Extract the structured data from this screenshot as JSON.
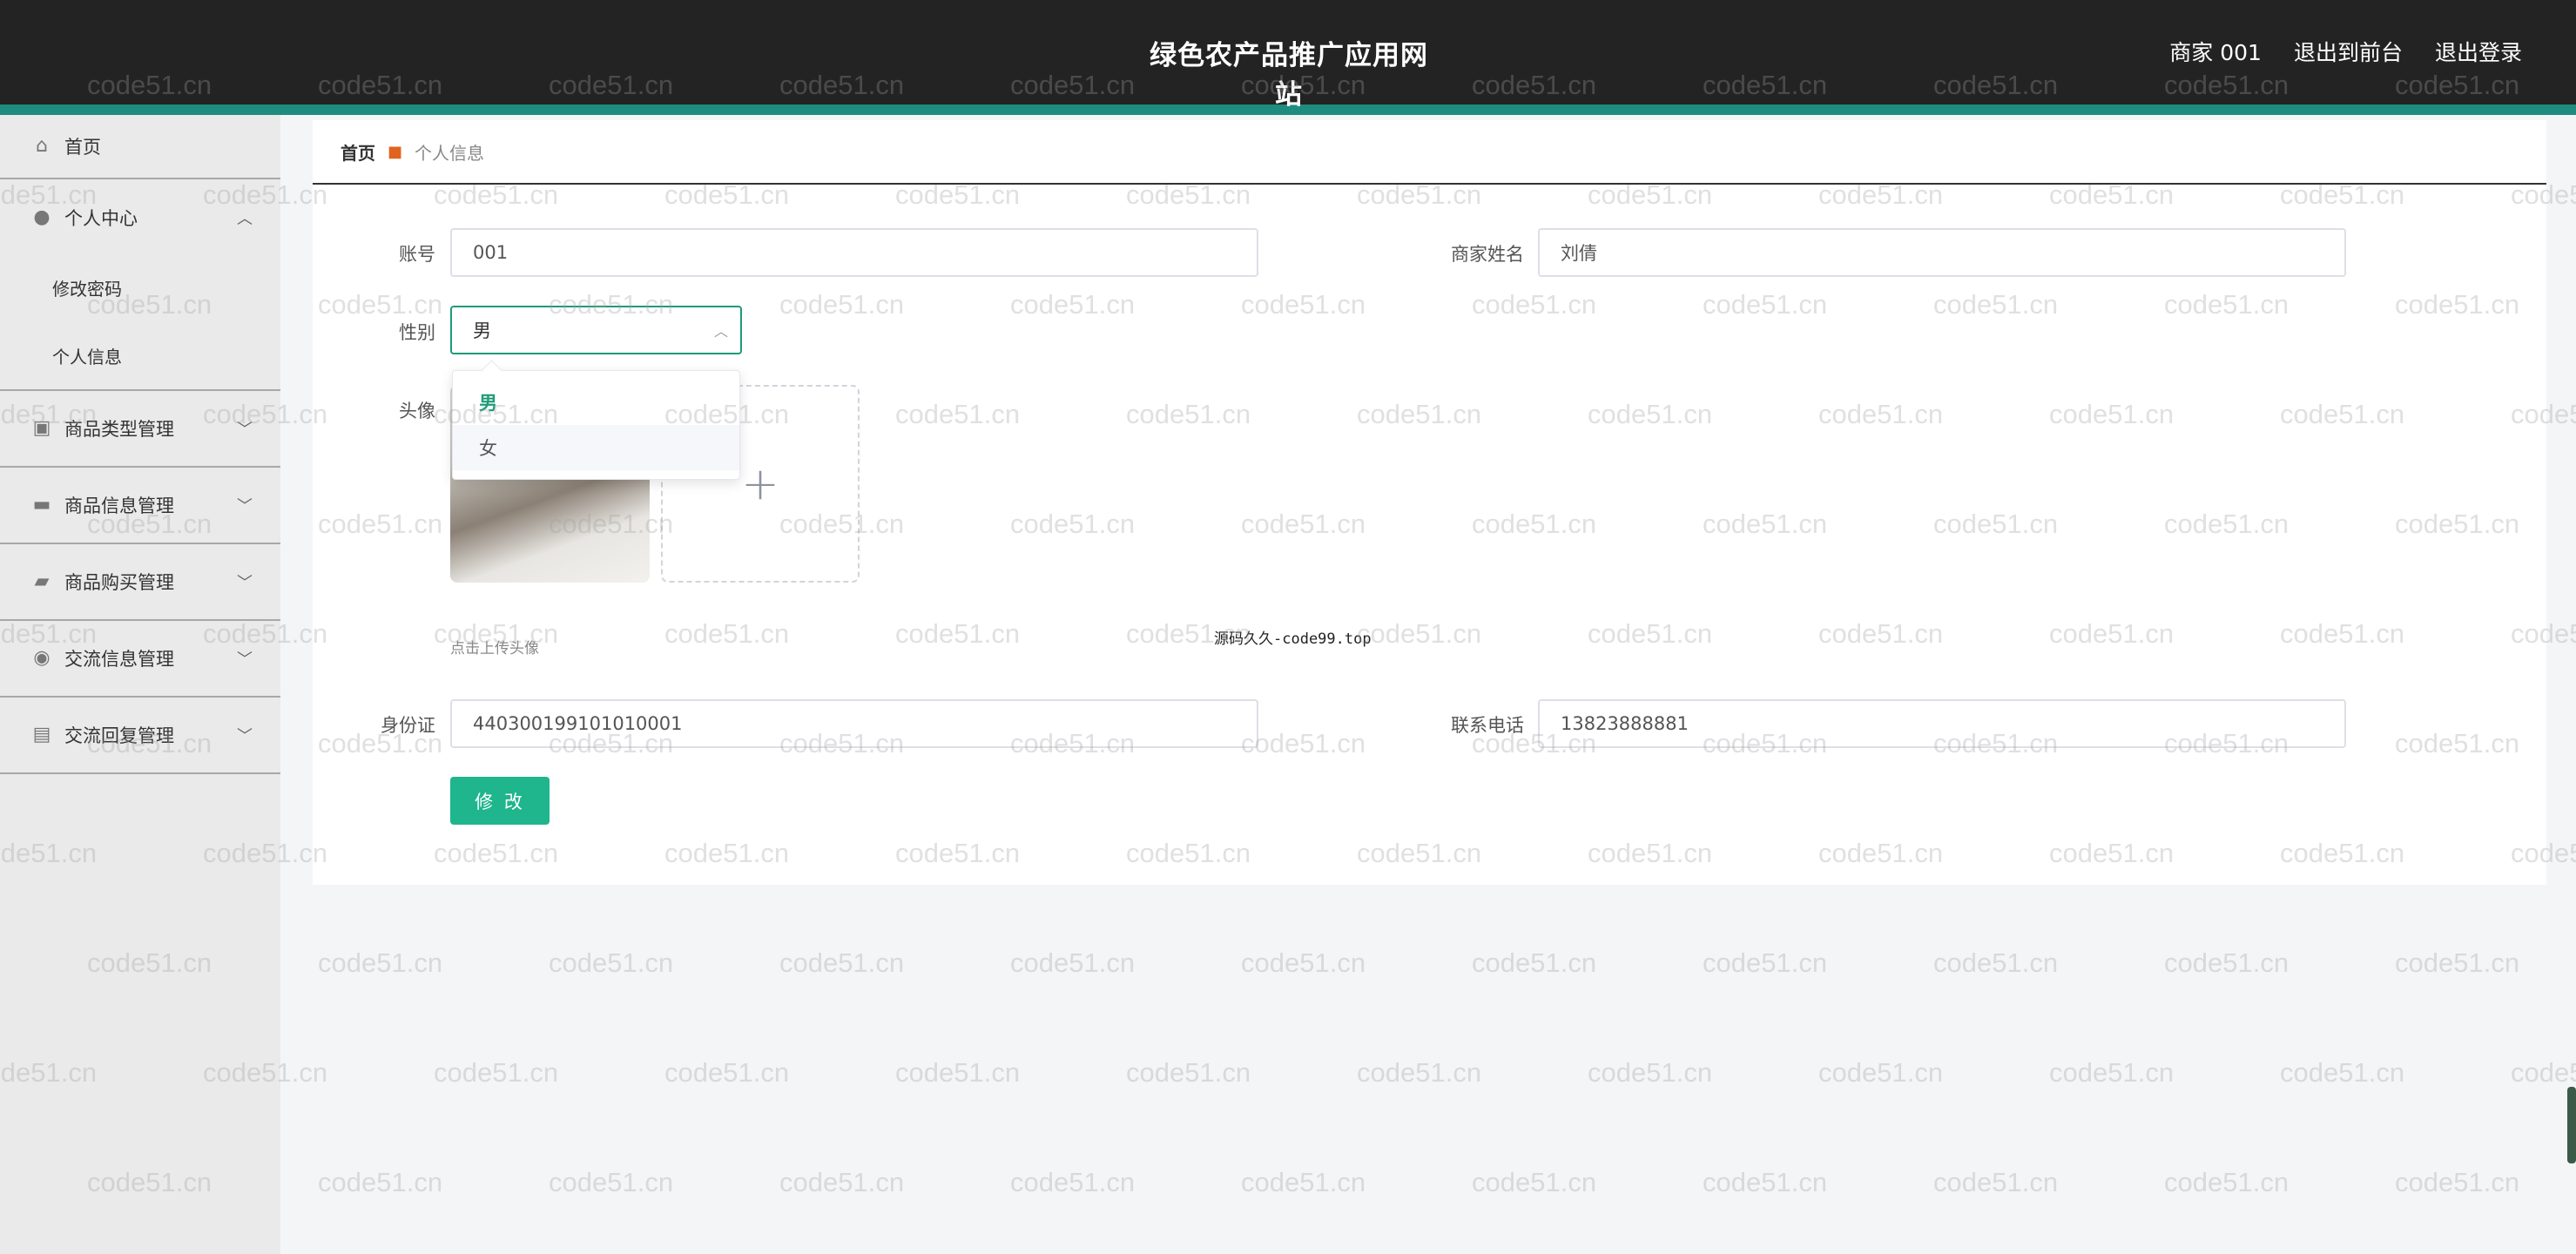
{
  "header": {
    "title": "绿色农产品推广应用网站",
    "links": [
      "商家 001",
      "退出到前台",
      "退出登录"
    ]
  },
  "sidebar": {
    "items": [
      {
        "label": "首页",
        "icon": "home-icon"
      },
      {
        "label": "个人中心",
        "icon": "user-icon",
        "expanded": true,
        "children": [
          "修改密码",
          "个人信息"
        ]
      },
      {
        "label": "商品类型管理",
        "icon": "box-icon"
      },
      {
        "label": "商品信息管理",
        "icon": "product-icon"
      },
      {
        "label": "商品购买管理",
        "icon": "ticket-icon"
      },
      {
        "label": "交流信息管理",
        "icon": "bulb-icon"
      },
      {
        "label": "交流回复管理",
        "icon": "chat-icon"
      }
    ]
  },
  "breadcrumb": {
    "home": "首页",
    "current": "个人信息"
  },
  "form": {
    "account": {
      "label": "账号",
      "value": "001"
    },
    "merchant_name": {
      "label": "商家姓名",
      "value": "刘倩"
    },
    "gender": {
      "label": "性别",
      "value": "男",
      "options": [
        "男",
        "女"
      ]
    },
    "avatar": {
      "label": "头像",
      "tip": "点击上传头像"
    },
    "id_card": {
      "label": "身份证",
      "value": "440300199101010001"
    },
    "phone": {
      "label": "联系电话",
      "value": "13823888881"
    },
    "submit_label": "修 改"
  },
  "source_note": "源码久久-code99.top",
  "watermark": "code51.cn",
  "colors": {
    "accent": "#1fb58d",
    "header": "#232323",
    "stripe": "#1e8c7e"
  }
}
